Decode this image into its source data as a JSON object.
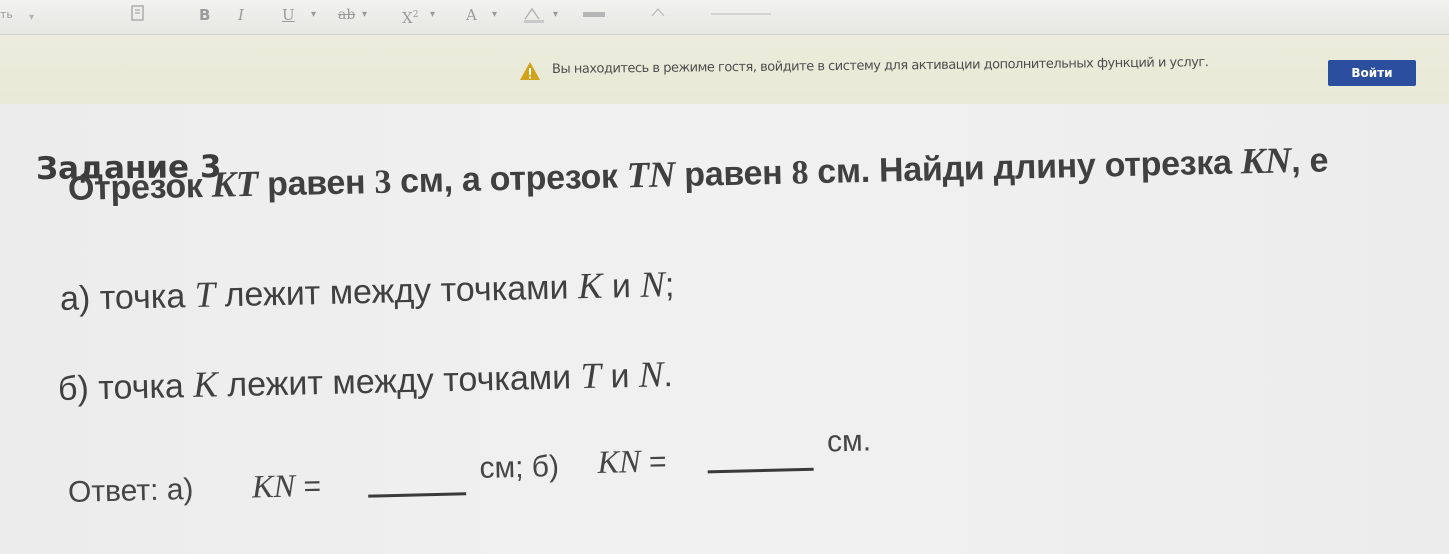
{
  "toolbar": {
    "style_select": "ть",
    "bold": "B",
    "italic": "I",
    "underline": "U",
    "strike": "ab",
    "superscript": "X",
    "font_color": "A"
  },
  "guest_bar": {
    "message": "Вы находитесь в режиме гостя, войдите в систему для активации дополнительных функций и услуг.",
    "login_label": "Войти",
    "warn_color": "#d2a21a",
    "button_color": "#2b4f9e"
  },
  "task": {
    "title": "Задание 3",
    "line1": {
      "p1": "Отрезок ",
      "v1": "KT",
      "p2": " равен ",
      "n1": "3",
      "p3": " см, а отрезок ",
      "v2": "TN",
      "p4": " равен ",
      "n2": "8",
      "p5": " см. Найди длину отрезка ",
      "v3": "KN",
      "p6": ", е"
    },
    "item_a": {
      "p1": "а) точка ",
      "v1": "T",
      "p2": " лежит между точками ",
      "v2": "K",
      "p3": " и ",
      "v3": "N",
      "p4": ";"
    },
    "item_b": {
      "p1": "б) точка ",
      "v1": "K",
      "p2": " лежит между точками ",
      "v2": "T",
      "p3": " и ",
      "v3": "N",
      "p4": "."
    }
  },
  "answer": {
    "label": "Ответ: а) ",
    "var_a": "KN",
    "eq_a": " =",
    "unit_a": "см; б) ",
    "var_b": "KN",
    "eq_b": " =",
    "unit_b": "см."
  }
}
